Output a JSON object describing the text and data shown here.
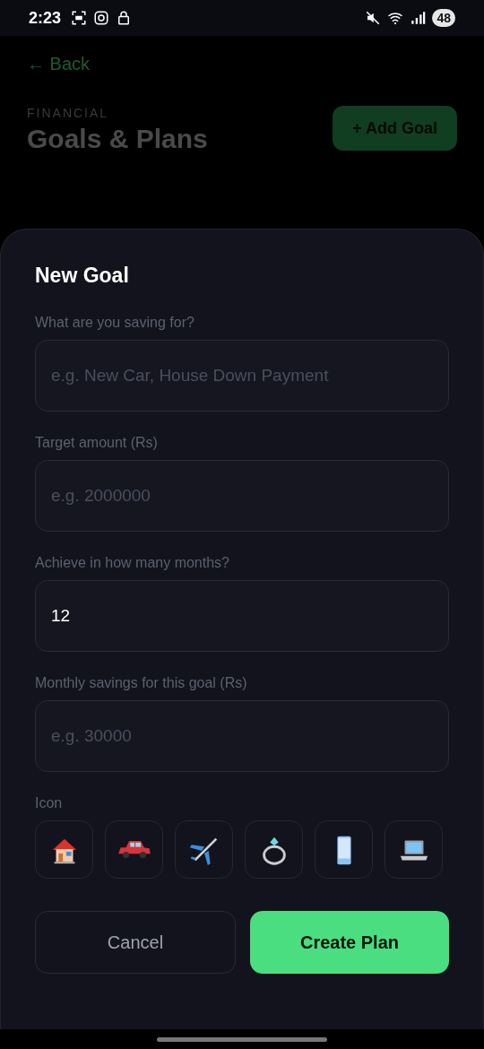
{
  "status_bar": {
    "time": "2:23",
    "battery": "48"
  },
  "header": {
    "back": "← Back",
    "eyebrow": "FINANCIAL",
    "title": "Goals & Plans",
    "add_button": "+ Add Goal"
  },
  "sheet": {
    "title": "New Goal",
    "fields": [
      {
        "label": "What are you saving for?",
        "placeholder": "e.g. New Car, House Down Payment"
      },
      {
        "label": "Target amount (Rs)",
        "placeholder": "e.g. 2000000"
      },
      {
        "label": "Achieve in how many months?",
        "value": "12"
      },
      {
        "label": "Monthly savings for this goal (Rs)",
        "placeholder": "e.g. 30000"
      }
    ],
    "icon_label": "Icon",
    "icons": [
      {
        "kind": "house",
        "selected": false
      },
      {
        "kind": "car",
        "selected": false
      },
      {
        "kind": "plane",
        "selected": false
      },
      {
        "kind": "ring",
        "selected": false
      },
      {
        "kind": "phone",
        "selected": false
      },
      {
        "kind": "laptop",
        "selected": false
      }
    ],
    "cancel": "Cancel",
    "submit": "Create Plan"
  }
}
